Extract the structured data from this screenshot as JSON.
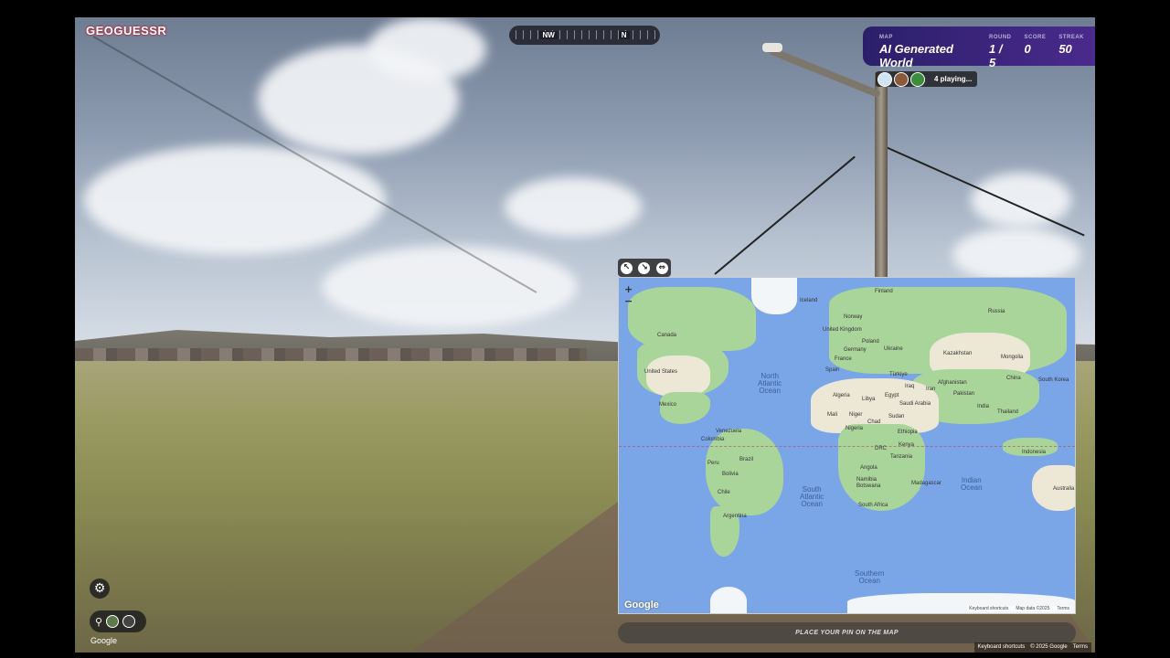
{
  "brand": {
    "logo_text": "GEOGUESSR"
  },
  "compass": {
    "left": "NW",
    "right": "N"
  },
  "status": {
    "map_label": "MAP",
    "map_value": "AI Generated World",
    "round_label": "ROUND",
    "round_value": "1 / 5",
    "score_label": "SCORE",
    "score_value": "0",
    "streak_label": "STREAK",
    "streak_value": "50"
  },
  "players": {
    "text": "4 playing..."
  },
  "map": {
    "zoom_in": "+",
    "zoom_out": "−",
    "labels": {
      "canada": "Canada",
      "us": "United States",
      "mexico": "Mexico",
      "venezuela": "Venezuela",
      "colombia": "Colombia",
      "peru": "Peru",
      "brazil": "Brazil",
      "bolivia": "Bolivia",
      "chile": "Chile",
      "argentina": "Argentina",
      "iceland": "Iceland",
      "finland": "Finland",
      "norway": "Norway",
      "uk": "United Kingdom",
      "poland": "Poland",
      "germany": "Germany",
      "france": "France",
      "ukraine": "Ukraine",
      "spain": "Spain",
      "russia": "Russia",
      "kazakhstan": "Kazakhstan",
      "mongolia": "Mongolia",
      "china": "China",
      "south_korea": "South Korea",
      "turkiye": "Türkiye",
      "iraq": "Iraq",
      "iran": "Iran",
      "afghanistan": "Afghanistan",
      "pakistan": "Pakistan",
      "india": "India",
      "thailand": "Thailand",
      "indonesia": "Indonesia",
      "australia": "Australia",
      "algeria": "Algeria",
      "libya": "Libya",
      "egypt": "Egypt",
      "saudi": "Saudi Arabia",
      "mali": "Mali",
      "niger": "Niger",
      "chad": "Chad",
      "sudan": "Sudan",
      "nigeria": "Nigeria",
      "ethiopia": "Ethiopia",
      "kenya": "Kenya",
      "drc": "DRC",
      "tanzania": "Tanzania",
      "angola": "Angola",
      "namibia": "Namibia",
      "botswana": "Botswana",
      "madagascar": "Madagascar",
      "south_africa": "South Africa"
    },
    "oceans": {
      "north_atlantic": "North\nAtlantic\nOcean",
      "south_atlantic": "South\nAtlantic\nOcean",
      "indian": "Indian\nOcean",
      "southern": "Southern\nOcean"
    },
    "google_mark": "Google",
    "footer": {
      "shortcuts": "Keyboard shortcuts",
      "data": "Map data ©2025",
      "terms": "Terms"
    }
  },
  "place_pin": "PLACE YOUR PIN ON THE MAP",
  "bottom": {
    "settings_icon": "⚙",
    "party_icon": "⚲",
    "google": "Google",
    "footer": {
      "shortcuts": "Keyboard shortcuts",
      "copyright": "© 2025 Google",
      "terms": "Terms"
    }
  },
  "colors": {
    "accent_purple": "#3a2580",
    "map_water": "#7aa6e8",
    "map_land": "#a9d59a"
  }
}
